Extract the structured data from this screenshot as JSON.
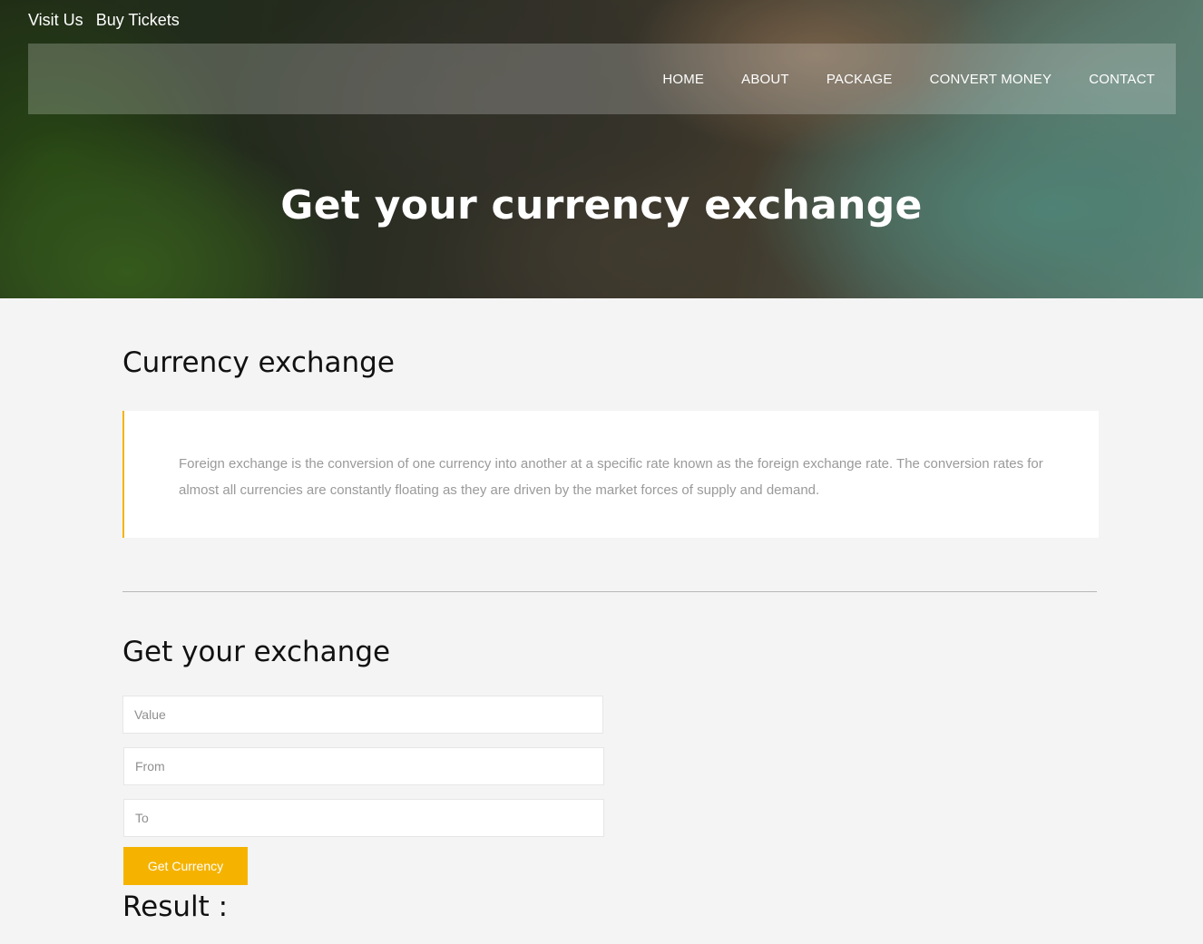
{
  "top_links": {
    "visit": "Visit Us",
    "tickets": "Buy Tickets"
  },
  "nav": {
    "items": [
      "HOME",
      "ABOUT",
      "PACKAGE",
      "CONVERT MONEY",
      "CONTACT"
    ]
  },
  "hero": {
    "title": "Get your currency exchange"
  },
  "about": {
    "title": "Currency exchange",
    "text": "Foreign exchange is the conversion of one currency into another at a specific rate known as the foreign exchange rate. The conversion rates for almost all currencies are constantly floating as they are driven by the market forces of supply and demand."
  },
  "form": {
    "title": "Get your exchange",
    "value_placeholder": "Value",
    "from_placeholder": "From",
    "to_placeholder": "To",
    "button_label": "Get Currency",
    "result_label": "Result :"
  },
  "colors": {
    "accent": "#f5b300",
    "background": "#f4f4f4"
  }
}
